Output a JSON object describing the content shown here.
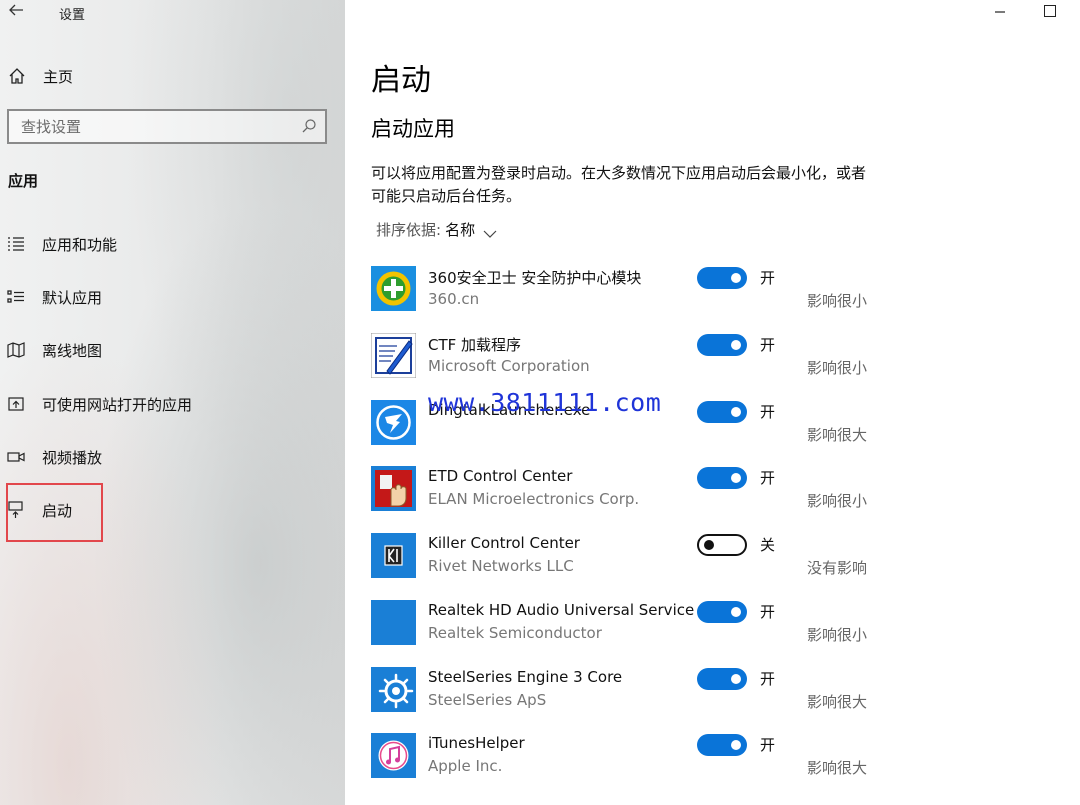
{
  "window": {
    "title": "设置"
  },
  "sidebar": {
    "home_label": "主页",
    "search_placeholder": "查找设置",
    "section_title": "应用",
    "items": [
      {
        "label": "应用和功能",
        "icon": "apps-features-icon"
      },
      {
        "label": "默认应用",
        "icon": "default-apps-icon"
      },
      {
        "label": "离线地图",
        "icon": "offline-maps-icon"
      },
      {
        "label": "可使用网站打开的应用",
        "icon": "apps-for-websites-icon"
      },
      {
        "label": "视频播放",
        "icon": "video-playback-icon"
      },
      {
        "label": "启动",
        "icon": "startup-icon"
      }
    ]
  },
  "main": {
    "title": "启动",
    "subtitle": "启动应用",
    "description": "可以将应用配置为登录时启动。在大多数情况下应用启动后会最小化，或者可能只启动后台任务。",
    "sort_key": "排序依据:",
    "sort_value": "名称",
    "apps": [
      {
        "name": "360安全卫士 安全防护中心模块",
        "publisher": "360.cn",
        "state": "开",
        "on": true,
        "impact": "影响很小",
        "icon": "360-safe-icon"
      },
      {
        "name": "CTF 加载程序",
        "publisher": "Microsoft Corporation",
        "state": "开",
        "on": true,
        "impact": "影响很小",
        "icon": "ctf-loader-icon"
      },
      {
        "name": "DingtalkLauncher.exe",
        "publisher": "",
        "state": "开",
        "on": true,
        "impact": "影响很大",
        "icon": "dingtalk-icon"
      },
      {
        "name": "ETD Control Center",
        "publisher": "ELAN Microelectronics Corp.",
        "state": "开",
        "on": true,
        "impact": "影响很小",
        "icon": "etd-control-icon"
      },
      {
        "name": "Killer Control Center",
        "publisher": "Rivet Networks LLC",
        "state": "关",
        "on": false,
        "impact": "没有影响",
        "icon": "killer-control-icon"
      },
      {
        "name": "Realtek HD Audio Universal Service",
        "publisher": "Realtek Semiconductor",
        "state": "开",
        "on": true,
        "impact": "影响很小",
        "icon": "realtek-audio-icon"
      },
      {
        "name": "SteelSeries Engine 3 Core",
        "publisher": "SteelSeries ApS",
        "state": "开",
        "on": true,
        "impact": "影响很大",
        "icon": "steelseries-icon"
      },
      {
        "name": "iTunesHelper",
        "publisher": "Apple Inc.",
        "state": "开",
        "on": true,
        "impact": "影响很大",
        "icon": "itunes-helper-icon"
      }
    ]
  },
  "watermark": "www.3811111.com",
  "colors": {
    "accent": "#0a74d8",
    "highlight": "#e2474c",
    "watermark": "#1f34d8"
  }
}
